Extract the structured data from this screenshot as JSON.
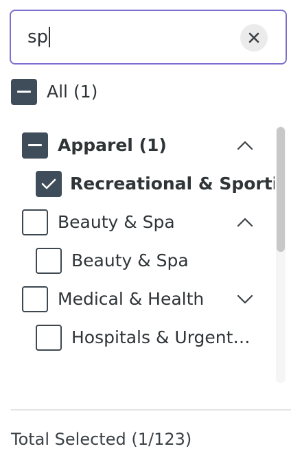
{
  "search": {
    "value": "sp",
    "clear_icon": "close-icon"
  },
  "all": {
    "label": "All (1)",
    "state": "indeterminate"
  },
  "tree": [
    {
      "label": "Apparel (1)",
      "state": "indeterminate",
      "expanded": true,
      "chevron": "chevron-up-icon",
      "children": [
        {
          "label": "Recreational & Sporting",
          "state": "checked"
        }
      ]
    },
    {
      "label": "Beauty & Spa",
      "state": "unchecked",
      "expanded": true,
      "chevron": "chevron-up-icon",
      "children": [
        {
          "label": "Beauty & Spa",
          "state": "unchecked"
        }
      ]
    },
    {
      "label": "Medical & Health",
      "state": "unchecked",
      "expanded": false,
      "chevron": "chevron-down-icon",
      "children": [
        {
          "label": "Hospitals & Urgent…",
          "state": "unchecked"
        }
      ]
    }
  ],
  "footer": {
    "total_selected": "Total Selected (1/123)"
  },
  "colors": {
    "focus_border": "#7b6fd0",
    "checkbox_fill": "#3e4d59",
    "text": "#2f3437"
  }
}
